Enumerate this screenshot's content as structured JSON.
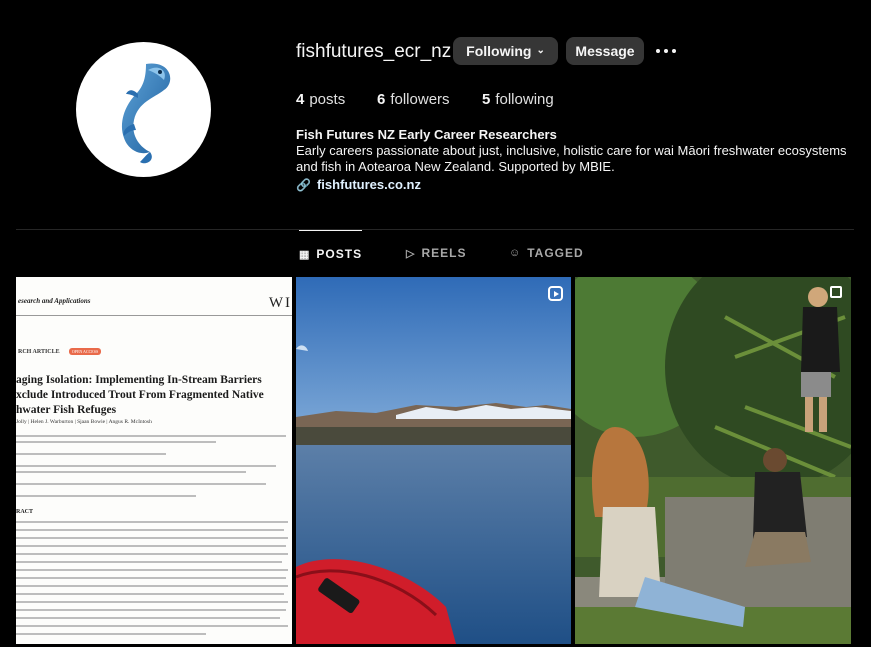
{
  "profile": {
    "username": "fishfutures_ecr_nz",
    "following_label": "Following",
    "message_label": "Message",
    "stats": {
      "posts_count": "4",
      "posts_label": "posts",
      "followers_count": "6",
      "followers_label": "followers",
      "following_count": "5",
      "following_label": "following"
    },
    "bio": {
      "name": "Fish Futures NZ Early Career Researchers",
      "text": "Early careers passionate about just, inclusive, holistic care for wai Māori freshwater ecosystems and fish in Aotearoa New Zealand. Supported by MBIE.",
      "link": "fishfutures.co.nz"
    }
  },
  "tabs": [
    {
      "label": "POSTS",
      "icon": "grid-icon",
      "active": true
    },
    {
      "label": "REELS",
      "icon": "reels-icon",
      "active": false
    },
    {
      "label": "TAGGED",
      "icon": "tagged-icon",
      "active": false
    }
  ],
  "posts": {
    "paper": {
      "journal": "esearch and Applications",
      "publisher": "WI",
      "article_type": "RCH ARTICLE",
      "badge": "OPEN ACCESS",
      "title": "aging Isolation: Implementing In-Stream Barriers xclude Introduced Trout From Fragmented Native hwater Fish Refuges",
      "authors": "Jolly | Helen J. Warburton | Sjaan Bowie | Angus R. McIntosh",
      "abstract_heading": "RACT"
    },
    "reel_icon": "reels-icon",
    "multi_icon": "carousel-icon"
  },
  "colors": {
    "background": "#000000",
    "button": "#363636",
    "link": "#e0f1ff"
  }
}
